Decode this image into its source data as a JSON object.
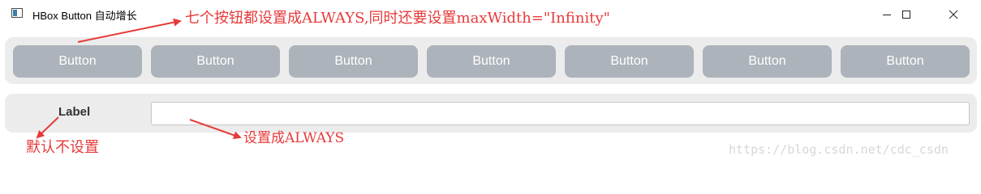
{
  "window": {
    "title": "HBox Button 自动增长",
    "minimize_icon": "minimize-icon",
    "maximize_icon": "maximize-icon",
    "close_icon": "close-icon"
  },
  "hbox_buttons": [
    {
      "label": "Button"
    },
    {
      "label": "Button"
    },
    {
      "label": "Button"
    },
    {
      "label": "Button"
    },
    {
      "label": "Button"
    },
    {
      "label": "Button"
    },
    {
      "label": "Button"
    }
  ],
  "form_row": {
    "label": "Label",
    "input_value": "",
    "input_placeholder": ""
  },
  "annotations": {
    "buttons_note": "七个按钮都设置成ALWAYS,同时还要设置maxWidth=\"Infinity\"",
    "input_note": "设置成ALWAYS",
    "label_note": "默认不设置"
  },
  "watermark": "https://blog.csdn.net/cdc_csdn",
  "colors": {
    "button_bg": "#adb3ba",
    "panel_bg": "#ececec",
    "annotation": "#e63a3a"
  }
}
